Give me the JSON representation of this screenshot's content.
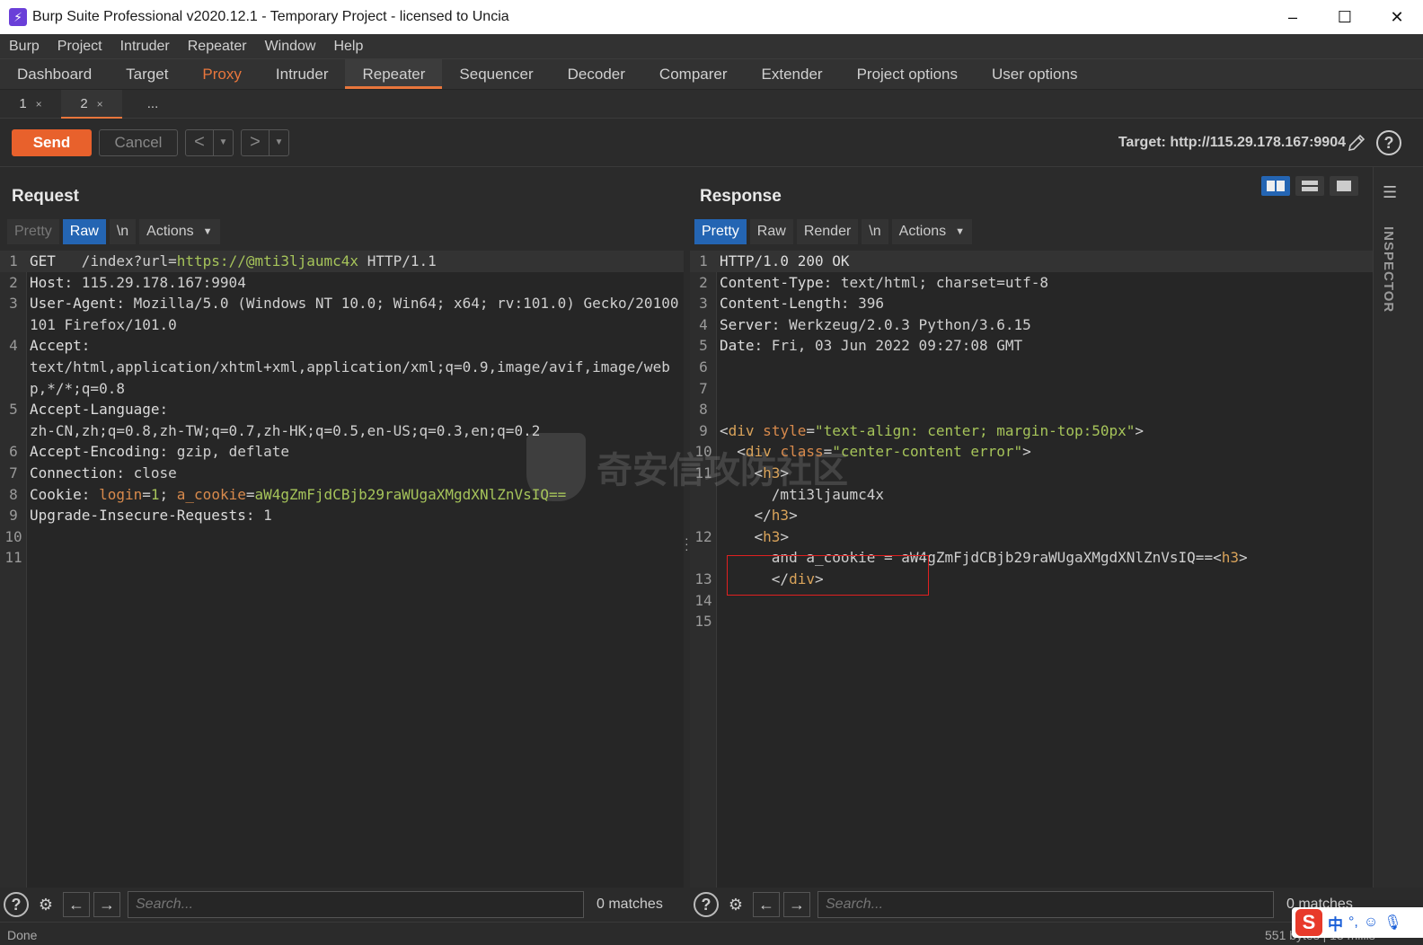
{
  "window": {
    "title": "Burp Suite Professional v2020.12.1 - Temporary Project - licensed to Uncia",
    "app_icon": "burp-lightning-icon",
    "controls": {
      "minimize": "–",
      "maximize": "☐",
      "close": "✕"
    }
  },
  "menu": [
    "Burp",
    "Project",
    "Intruder",
    "Repeater",
    "Window",
    "Help"
  ],
  "main_tabs": [
    "Dashboard",
    "Target",
    "Proxy",
    "Intruder",
    "Repeater",
    "Sequencer",
    "Decoder",
    "Comparer",
    "Extender",
    "Project options",
    "User options"
  ],
  "active_main_tab": "Repeater",
  "highlight_tab_color": "#e8763c",
  "sub_tabs": [
    {
      "label": "1",
      "close": "×"
    },
    {
      "label": "2",
      "close": "×"
    },
    {
      "label": "..."
    }
  ],
  "active_sub_tab": "2",
  "toolbar": {
    "send": "Send",
    "cancel": "Cancel",
    "back": "<",
    "forward": ">",
    "dropdown": "▼",
    "target": "Target: http://115.29.178.167:9904",
    "edit_icon": "pencil-icon",
    "help_icon": "help-icon"
  },
  "request": {
    "title": "Request",
    "tabs": {
      "pretty": "Pretty",
      "raw": "Raw",
      "newline": "\\n",
      "actions": "Actions"
    },
    "active_tab": "Raw",
    "lines": [
      {
        "n": "1",
        "parts": [
          [
            "k",
            "GET  "
          ],
          [
            "v",
            " /index?url="
          ],
          [
            "g",
            "https://@mti3ljaumc4x"
          ],
          [
            "v",
            " HTTP/1.1"
          ]
        ]
      },
      {
        "n": "2",
        "parts": [
          [
            "k",
            "Host"
          ],
          [
            "v",
            ": 115.29.178.167:9904"
          ]
        ]
      },
      {
        "n": "3",
        "parts": [
          [
            "k",
            "User-Agent"
          ],
          [
            "v",
            ": Mozilla/5.0 (Windows NT 10.0; Win64; x64; rv:101.0) Gecko/20100101 Firefox/101.0"
          ]
        ]
      },
      {
        "n": "4",
        "parts": [
          [
            "k",
            "Accept"
          ],
          [
            "v",
            ":\ntext/html,application/xhtml+xml,application/xml;q=0.9,image/avif,image/webp,*/*;q=0.8"
          ]
        ]
      },
      {
        "n": "5",
        "parts": [
          [
            "k",
            "Accept-Language"
          ],
          [
            "v",
            ":\nzh-CN,zh;q=0.8,zh-TW;q=0.7,zh-HK;q=0.5,en-US;q=0.3,en;q=0.2"
          ]
        ]
      },
      {
        "n": "6",
        "parts": [
          [
            "k",
            "Accept-Encoding"
          ],
          [
            "v",
            ": gzip, deflate"
          ]
        ]
      },
      {
        "n": "7",
        "parts": [
          [
            "k",
            "Connection"
          ],
          [
            "v",
            ": close"
          ]
        ]
      },
      {
        "n": "8",
        "parts": [
          [
            "k",
            "Cookie"
          ],
          [
            "v",
            ": "
          ],
          [
            "o",
            "login"
          ],
          [
            "v",
            "="
          ],
          [
            "g",
            "1"
          ],
          [
            "v",
            "; "
          ],
          [
            "o",
            "a_cookie"
          ],
          [
            "v",
            "="
          ],
          [
            "g",
            "aW4gZmFjdCBjb29raWUgaXMgdXNlZnVsIQ=="
          ]
        ]
      },
      {
        "n": "9",
        "parts": [
          [
            "k",
            "Upgrade-Insecure-Requests"
          ],
          [
            "v",
            ": 1"
          ]
        ]
      },
      {
        "n": "10",
        "parts": []
      },
      {
        "n": "11",
        "parts": []
      }
    ]
  },
  "response": {
    "title": "Response",
    "tabs": {
      "pretty": "Pretty",
      "raw": "Raw",
      "render": "Render",
      "newline": "\\n",
      "actions": "Actions"
    },
    "active_tab": "Pretty",
    "lines": [
      {
        "n": "1",
        "parts": [
          [
            "k",
            "HTTP/1.0 200 OK"
          ]
        ]
      },
      {
        "n": "2",
        "parts": [
          [
            "k",
            "Content-Type"
          ],
          [
            "v",
            ": text/html; charset=utf-8"
          ]
        ]
      },
      {
        "n": "3",
        "parts": [
          [
            "k",
            "Content-Length"
          ],
          [
            "v",
            ": 396"
          ]
        ]
      },
      {
        "n": "4",
        "parts": [
          [
            "k",
            "Server"
          ],
          [
            "v",
            ": Werkzeug/2.0.3 Python/3.6.15"
          ]
        ]
      },
      {
        "n": "5",
        "parts": [
          [
            "k",
            "Date"
          ],
          [
            "v",
            ": Fri, 03 Jun 2022 09:27:08 GMT"
          ]
        ]
      },
      {
        "n": "6",
        "parts": []
      },
      {
        "n": "7",
        "parts": []
      },
      {
        "n": "8",
        "parts": []
      },
      {
        "n": "9",
        "parts": [
          [
            "v",
            "<"
          ],
          [
            "tag",
            "div"
          ],
          [
            "o",
            " style"
          ],
          [
            "v",
            "="
          ],
          [
            "g",
            "\"text-align: center; margin-top:50px\""
          ],
          [
            "v",
            ">"
          ]
        ]
      },
      {
        "n": "10",
        "parts": [
          [
            "v",
            "  <"
          ],
          [
            "tag",
            "div"
          ],
          [
            "o",
            " class"
          ],
          [
            "v",
            "="
          ],
          [
            "g",
            "\"center-content error\""
          ],
          [
            "v",
            ">"
          ]
        ]
      },
      {
        "n": "11",
        "parts": [
          [
            "v",
            "    <"
          ],
          [
            "tag",
            "h3"
          ],
          [
            "v",
            ">\n      /mti3ljaumc4x\n    </"
          ],
          [
            "tag",
            "h3"
          ],
          [
            "v",
            ">"
          ]
        ]
      },
      {
        "n": "12",
        "parts": [
          [
            "v",
            "    <"
          ],
          [
            "tag",
            "h3"
          ],
          [
            "v",
            ">\n      and a_cookie = aW4gZmFjdCBjb29raWUgaXMgdXNlZnVsIQ==<"
          ],
          [
            "tag",
            "h3"
          ],
          [
            "v",
            ">"
          ]
        ]
      },
      {
        "n": "13",
        "parts": [
          [
            "v",
            "      </"
          ],
          [
            "tag",
            "div"
          ],
          [
            "v",
            ">"
          ]
        ]
      },
      {
        "n": "14",
        "parts": []
      },
      {
        "n": "15",
        "parts": []
      }
    ]
  },
  "inspector": {
    "label": "INSPECTOR"
  },
  "search": {
    "placeholder": "Search...",
    "req_matches": "0 matches",
    "resp_matches": "0 matches"
  },
  "status": {
    "left": "Done",
    "right": "551 bytes | 13 millis"
  },
  "ime": {
    "logo": "S",
    "lang": "中",
    "punct": "°,",
    "emoji": "☺",
    "mic": "🎙"
  },
  "watermark": "奇安信攻防社区"
}
